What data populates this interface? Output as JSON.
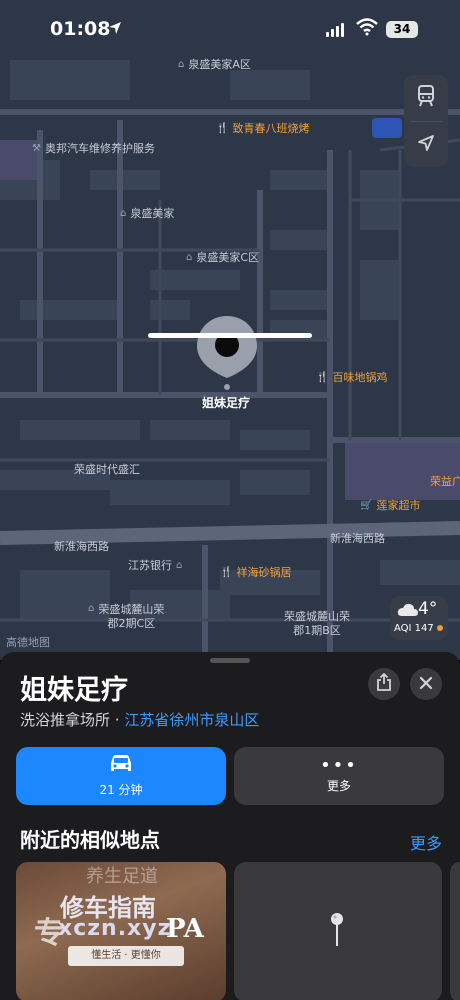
{
  "status_bar": {
    "time": "01:08",
    "battery": "34"
  },
  "map": {
    "pois": [
      {
        "label": "泉盛美家A区",
        "kind": "place"
      },
      {
        "label": "致青春八班烧烤",
        "kind": "food"
      },
      {
        "label": "奥邦汽车维修养护服务",
        "kind": "place"
      },
      {
        "label": "泉盛美家",
        "kind": "place"
      },
      {
        "label": "泉盛美家C区",
        "kind": "place"
      },
      {
        "label": "百味地锅鸡",
        "kind": "food"
      },
      {
        "label": "荣盛时代盛汇",
        "kind": "place"
      },
      {
        "label": "荣益广",
        "kind": "food"
      },
      {
        "label": "莲家超市",
        "kind": "food"
      },
      {
        "label": "江苏银行",
        "kind": "place"
      },
      {
        "label": "祥海砂锅居",
        "kind": "food"
      },
      {
        "label": "荣盛城麓山荣\n郡2期C区",
        "kind": "place"
      },
      {
        "label": "荣盛城麓山荣\n郡1期B区",
        "kind": "place"
      }
    ],
    "roads": [
      "新淮海西路",
      "新淮海西路"
    ],
    "pin_label": "姐妹足疗",
    "legal": "高德地图",
    "weather": {
      "temp": "4°",
      "aqi": "AQI 147"
    }
  },
  "sheet": {
    "title": "姐妹足疗",
    "category": "洗浴推拿场所 · ",
    "location_link": "江苏省徐州市泉山区",
    "actions": {
      "drive_label": "21 分钟",
      "more_label": "更多"
    },
    "nearby_title": "附近的相似地点",
    "nearby_more": "更多",
    "card1": {
      "watermark_line1": "修车指南",
      "watermark_line2": "xczn.xyz",
      "big_char": "专",
      "pa_text": "PA",
      "top_text": "养生足道",
      "slogan": "懂生活 · 更懂你"
    }
  },
  "colors": {
    "accent": "#1c87ff",
    "link": "#3b9bff",
    "food_poi": "#f3a03c",
    "map_bg": "#2e3748"
  }
}
